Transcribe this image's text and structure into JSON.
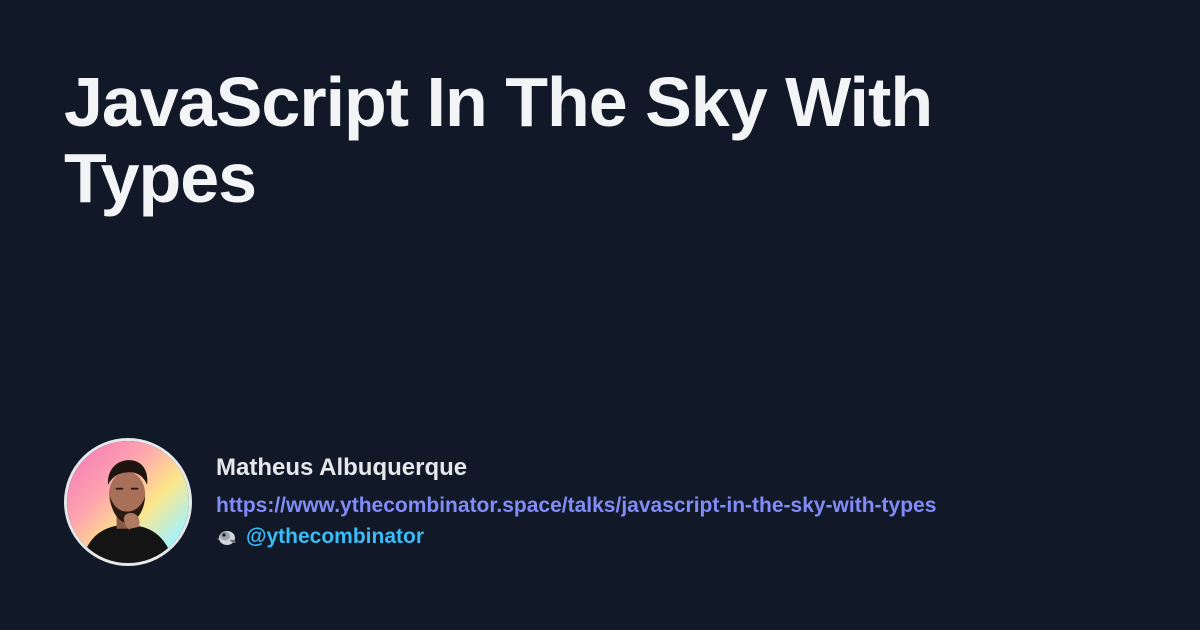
{
  "title": "JavaScript In The Sky With Types",
  "author": {
    "name": "Matheus Albuquerque",
    "url": "https://www.ythecombinator.space/talks/javascript-in-the-sky-with-types",
    "handle": "@ythecombinator",
    "handle_icon": "bird-emoji-icon",
    "avatar": "author-photo"
  },
  "colors": {
    "background": "#111827",
    "title": "#f3f4f6",
    "url": "#818cf8",
    "handle": "#38bdf8"
  }
}
